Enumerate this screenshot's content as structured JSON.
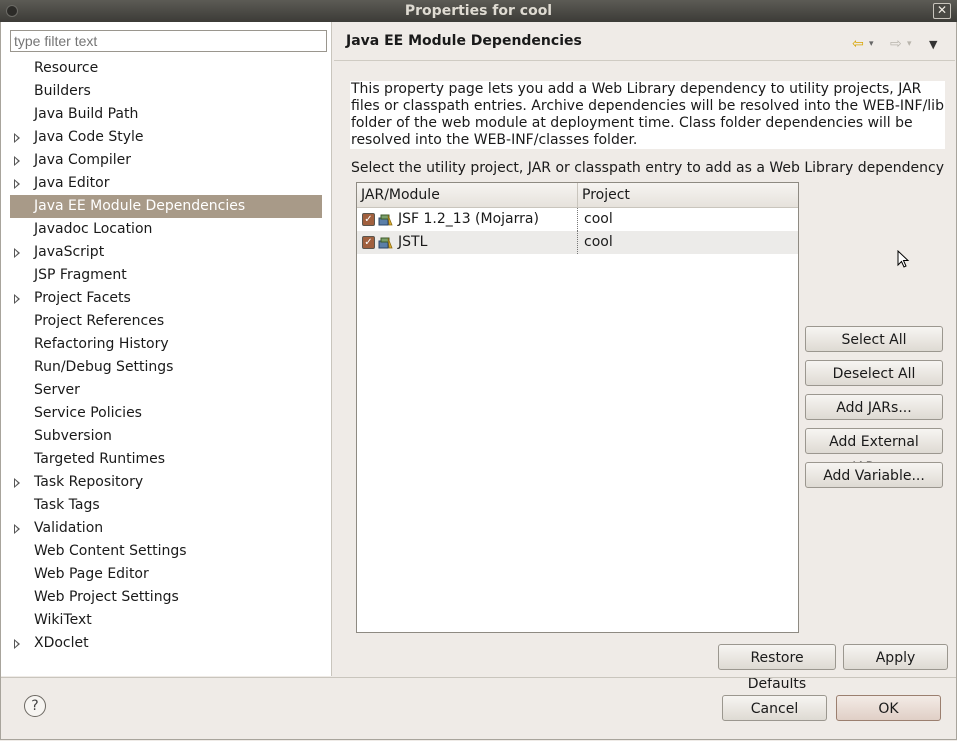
{
  "window": {
    "title": "Properties for cool"
  },
  "filter": {
    "placeholder": "type filter text"
  },
  "tree": {
    "items": [
      {
        "label": "Resource",
        "expandable": false
      },
      {
        "label": "Builders",
        "expandable": false
      },
      {
        "label": "Java Build Path",
        "expandable": false
      },
      {
        "label": "Java Code Style",
        "expandable": true
      },
      {
        "label": "Java Compiler",
        "expandable": true
      },
      {
        "label": "Java Editor",
        "expandable": true
      },
      {
        "label": "Java EE Module Dependencies",
        "expandable": false,
        "selected": true
      },
      {
        "label": "Javadoc Location",
        "expandable": false
      },
      {
        "label": "JavaScript",
        "expandable": true
      },
      {
        "label": "JSP Fragment",
        "expandable": false
      },
      {
        "label": "Project Facets",
        "expandable": true
      },
      {
        "label": "Project References",
        "expandable": false
      },
      {
        "label": "Refactoring History",
        "expandable": false
      },
      {
        "label": "Run/Debug Settings",
        "expandable": false
      },
      {
        "label": "Server",
        "expandable": false
      },
      {
        "label": "Service Policies",
        "expandable": false
      },
      {
        "label": "Subversion",
        "expandable": false
      },
      {
        "label": "Targeted Runtimes",
        "expandable": false
      },
      {
        "label": "Task Repository",
        "expandable": true
      },
      {
        "label": "Task Tags",
        "expandable": false
      },
      {
        "label": "Validation",
        "expandable": true
      },
      {
        "label": "Web Content Settings",
        "expandable": false
      },
      {
        "label": "Web Page Editor",
        "expandable": false
      },
      {
        "label": "Web Project Settings",
        "expandable": false
      },
      {
        "label": "WikiText",
        "expandable": false
      },
      {
        "label": "XDoclet",
        "expandable": true
      }
    ]
  },
  "page": {
    "title": "Java EE Module Dependencies",
    "description": "This property page lets you add a Web Library dependency to utility projects, JAR files or classpath entries. Archive dependencies will be resolved into the WEB-INF/lib folder of the web module at deployment time. Class folder dependencies will be resolved into the WEB-INF/classes folder.",
    "select_label": "Select the utility project, JAR or classpath entry to add as a Web Library dependency",
    "table": {
      "columns": [
        "JAR/Module",
        "Project"
      ],
      "rows": [
        {
          "module": "JSF 1.2_13 (Mojarra)",
          "project": "cool",
          "checked": true
        },
        {
          "module": "JSTL",
          "project": "cool",
          "checked": true
        }
      ]
    },
    "buttons": {
      "select_all": "Select All",
      "deselect_all": "Deselect All",
      "add_jars": "Add JARs...",
      "add_external_jars": "Add External JARs...",
      "add_variable": "Add Variable...",
      "restore_defaults": "Restore Defaults",
      "apply": "Apply"
    }
  },
  "dialog_buttons": {
    "cancel": "Cancel",
    "ok": "OK"
  },
  "icons": [
    "close-icon",
    "back-arrow-icon",
    "forward-arrow-icon",
    "view-menu-icon",
    "help-icon",
    "library-icon",
    "checkbox-icon",
    "expand-arrow-icon"
  ],
  "colors": {
    "selection": "#a89a88",
    "checkbox": "#a1603e",
    "titlebar": "#3c3b37"
  }
}
